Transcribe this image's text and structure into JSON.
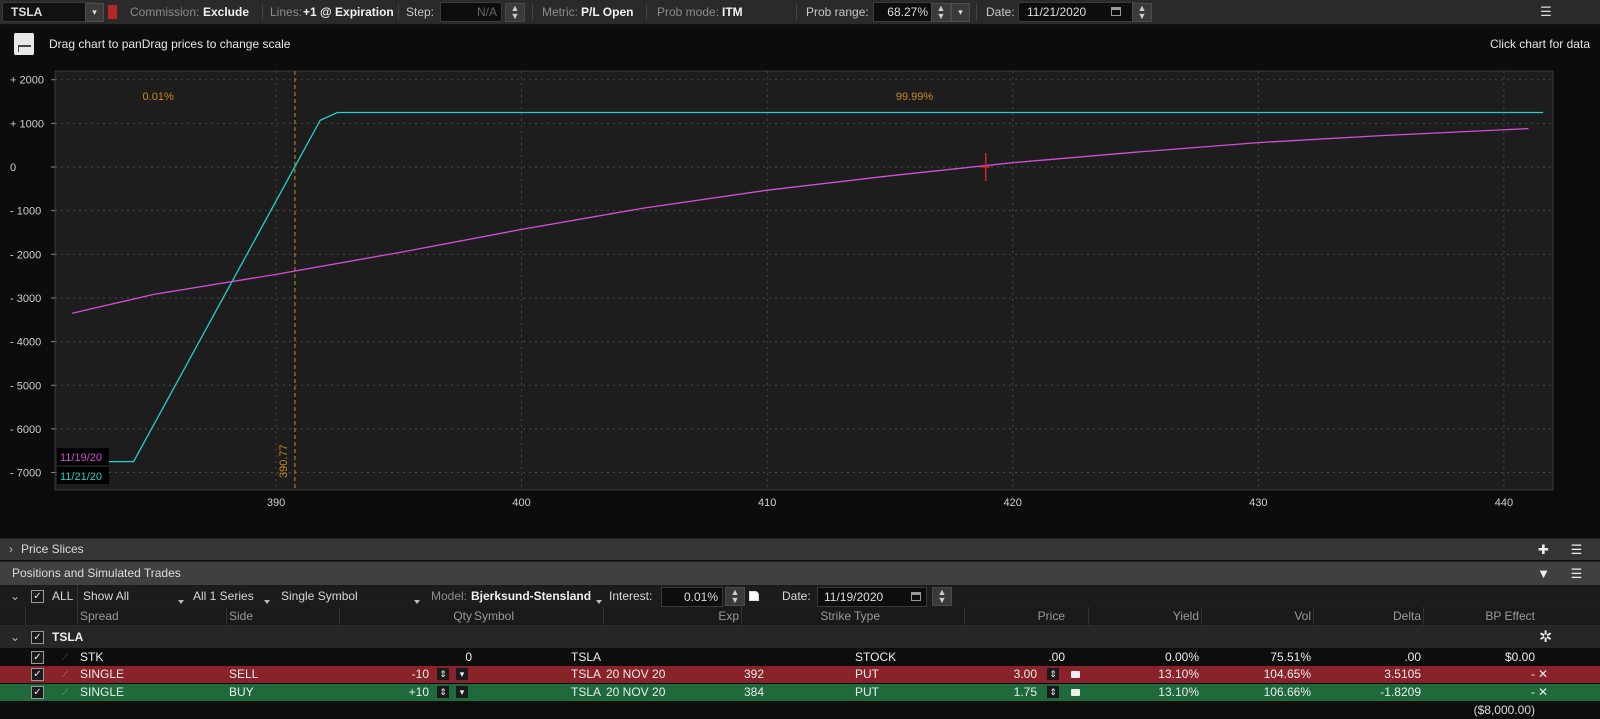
{
  "toolbar": {
    "symbol": "TSLA",
    "commission_label": "Commission:",
    "commission_value": "Exclude",
    "lines_label": "Lines:",
    "lines_value": "+1 @ Expiration",
    "step_label": "Step:",
    "step_value": "N/A",
    "metric_label": "Metric:",
    "metric_value": "P/L Open",
    "prob_mode_label": "Prob mode:",
    "prob_mode_value": "ITM",
    "prob_range_label": "Prob range:",
    "prob_range_value": "68.27%",
    "date_label": "Date:",
    "date_value": "11/21/2020"
  },
  "chart_header": {
    "hint": "Drag chart to panDrag prices to change scale",
    "click_hint": "Click chart for data"
  },
  "colors": {
    "series_expiration": "#1fd1cf",
    "series_current": "#d34fd6",
    "prob_line": "#c98a1e",
    "marker": "#d02525"
  },
  "chart_data": {
    "type": "line",
    "xlim": [
      381,
      442
    ],
    "ylim": [
      -7400,
      2200
    ],
    "x_ticks": [
      390,
      400,
      410,
      420,
      430,
      440
    ],
    "y_ticks": [
      2000,
      1000,
      0,
      -1000,
      -2000,
      -3000,
      -4000,
      -5000,
      -6000,
      -7000
    ],
    "y_tick_labels": [
      "+ 2000",
      "+ 1000",
      "0",
      "- 1000",
      "- 2000",
      "- 3000",
      "- 4000",
      "- 5000",
      "- 6000",
      "- 7000"
    ],
    "series": [
      {
        "name": "11/21/20",
        "color": "#1fd1cf",
        "x": [
          381.5,
          384.2,
          391.8,
          392.5,
          441.6
        ],
        "y": [
          -6750,
          -6750,
          1070,
          1250,
          1250
        ]
      },
      {
        "name": "11/19/20",
        "color": "#d34fd6",
        "x": [
          381.7,
          385,
          390,
          395,
          400,
          405,
          410,
          415,
          420,
          425,
          430,
          435,
          441.0
        ],
        "y": [
          -3350,
          -2920,
          -2460,
          -1960,
          -1430,
          -940,
          -530,
          -200,
          100,
          340,
          560,
          720,
          880
        ]
      }
    ],
    "prob_line_x": 390.77,
    "prob_line_label": "390.77",
    "prob_left_label": "0.01%",
    "prob_right_label": "99.99%",
    "marker_x": 418.9,
    "marker_y": 0
  },
  "price_slices": {
    "label": "Price Slices"
  },
  "positions": {
    "label": "Positions and Simulated Trades"
  },
  "filters": {
    "all_label": "ALL",
    "show_all": "Show All",
    "series": "All 1 Series",
    "symbol_mode": "Single Symbol",
    "model_label": "Model:",
    "model_value": "Bjerksund-Stensland",
    "interest_label": "Interest:",
    "interest_value": "0.01%",
    "date_label": "Date:",
    "date_value": "11/19/2020"
  },
  "columns": {
    "spread": "Spread",
    "side": "Side",
    "qty": "Qty",
    "symbol": "Symbol",
    "exp": "Exp",
    "strike": "Strike",
    "type": "Type",
    "price": "Price",
    "yield": "Yield",
    "vol": "Vol",
    "delta": "Delta",
    "bp_effect": "BP Effect"
  },
  "group": {
    "name": "TSLA"
  },
  "rows": [
    {
      "spread": "STK",
      "side": "",
      "qty": "0",
      "symbol": "TSLA",
      "exp": "",
      "strike": "",
      "type": "STOCK",
      "price": ".00",
      "yield": "0.00%",
      "vol": "75.51%",
      "delta": ".00",
      "bp": "$0.00"
    },
    {
      "spread": "SINGLE",
      "side": "SELL",
      "qty": "-10",
      "symbol": "TSLA",
      "exp": "20 NOV 20",
      "strike": "392",
      "type": "PUT",
      "price": "3.00",
      "yield": "13.10%",
      "vol": "104.65%",
      "delta": "3.5105",
      "bp": "-"
    },
    {
      "spread": "SINGLE",
      "side": "BUY",
      "qty": "+10",
      "symbol": "TSLA",
      "exp": "20 NOV 20",
      "strike": "384",
      "type": "PUT",
      "price": "1.75",
      "yield": "13.10%",
      "vol": "106.66%",
      "delta": "-1.8209",
      "bp": "-"
    }
  ],
  "total": {
    "bp": "($8,000.00)"
  }
}
